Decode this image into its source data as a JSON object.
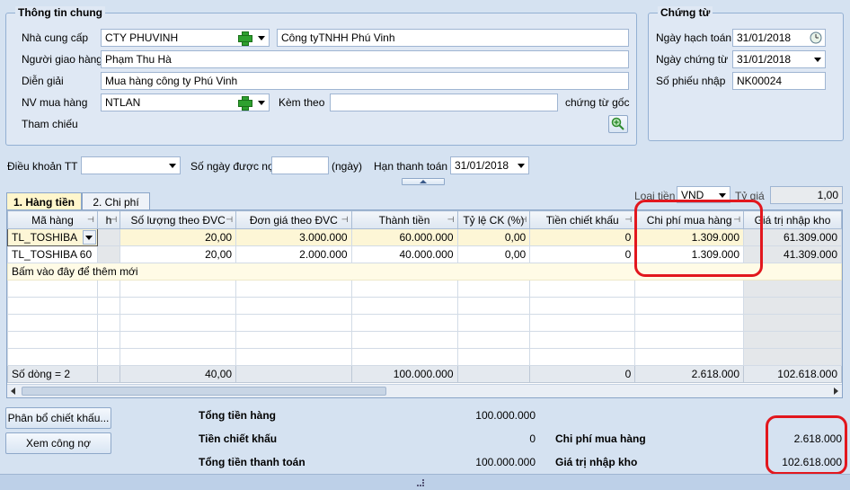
{
  "general": {
    "title": "Thông tin chung",
    "supplier_label": "Nhà cung cấp",
    "supplier_code": "CTY PHUVINH",
    "supplier_name": "Công tyTNHH Phú Vinh",
    "deliverer_label": "Người giao hàng",
    "deliverer_value": "Phạm Thu Hà",
    "description_label": "Diễn giải",
    "description_value": "Mua hàng công ty Phú Vinh",
    "buyer_label": "NV mua hàng",
    "buyer_value": "NTLAN",
    "attach_label": "Kèm theo",
    "attach_value": "",
    "original_docs_label": "chứng từ gốc",
    "reference_label": "Tham chiếu"
  },
  "voucher": {
    "title": "Chứng từ",
    "posting_date_label": "Ngày hạch toán",
    "posting_date": "31/01/2018",
    "voucher_date_label": "Ngày chứng từ",
    "voucher_date": "31/01/2018",
    "receipt_no_label": "Số phiếu nhập",
    "receipt_no": "NK00024"
  },
  "terms": {
    "payment_terms_label": "Điều khoản TT",
    "payment_terms_value": "",
    "debt_days_label": "Số ngày được nợ",
    "debt_days_value": "",
    "days_unit": "(ngày)",
    "due_date_label": "Hạn thanh toán",
    "due_date": "31/01/2018"
  },
  "tabs": [
    {
      "label": "1. Hàng tiền"
    },
    {
      "label": "2. Chi phí"
    }
  ],
  "currency": {
    "label": "Loại tiền",
    "value": "VND",
    "rate_label": "Tỷ giá",
    "rate_value": "1,00"
  },
  "grid": {
    "columns": [
      "Mã hàng",
      "h",
      "Số lượng theo ĐVC",
      "Đơn giá theo ĐVC",
      "Thành tiền",
      "Tỷ lệ CK (%)",
      "Tiền chiết khấu",
      "Chi phí mua hàng",
      "Giá trị nhập kho"
    ],
    "rows": [
      {
        "code": "TL_TOSHIBA",
        "qty": "20,00",
        "price": "3.000.000",
        "amount": "60.000.000",
        "disc_rate": "0,00",
        "disc_amount": "0",
        "purchase_cost": "1.309.000",
        "stock_value": "61.309.000"
      },
      {
        "code": "TL_TOSHIBA 60",
        "qty": "20,00",
        "price": "2.000.000",
        "amount": "40.000.000",
        "disc_rate": "0,00",
        "disc_amount": "0",
        "purchase_cost": "1.309.000",
        "stock_value": "41.309.000"
      }
    ],
    "new_row_hint": "Bấm vào đây để thêm mới",
    "summary": {
      "row_count": "Số dòng = 2",
      "qty": "40,00",
      "amount": "100.000.000",
      "disc_amount": "0",
      "purchase_cost": "2.618.000",
      "stock_value": "102.618.000"
    }
  },
  "buttons": {
    "allocate_discount": "Phân bổ chiết khấu...",
    "view_debt": "Xem công nợ"
  },
  "totals": {
    "goods_total_label": "Tổng tiền hàng",
    "goods_total": "100.000.000",
    "discount_label": "Tiền chiết khấu",
    "discount": "0",
    "payment_total_label": "Tổng tiền thanh toán",
    "payment_total": "100.000.000",
    "purchase_cost_label": "Chi phí mua hàng",
    "purchase_cost": "2.618.000",
    "stock_value_label": "Giá trị nhập kho",
    "stock_value": "102.618.000"
  },
  "colors": {
    "annotation": "#e2171e",
    "background": "#d5e2f1"
  }
}
